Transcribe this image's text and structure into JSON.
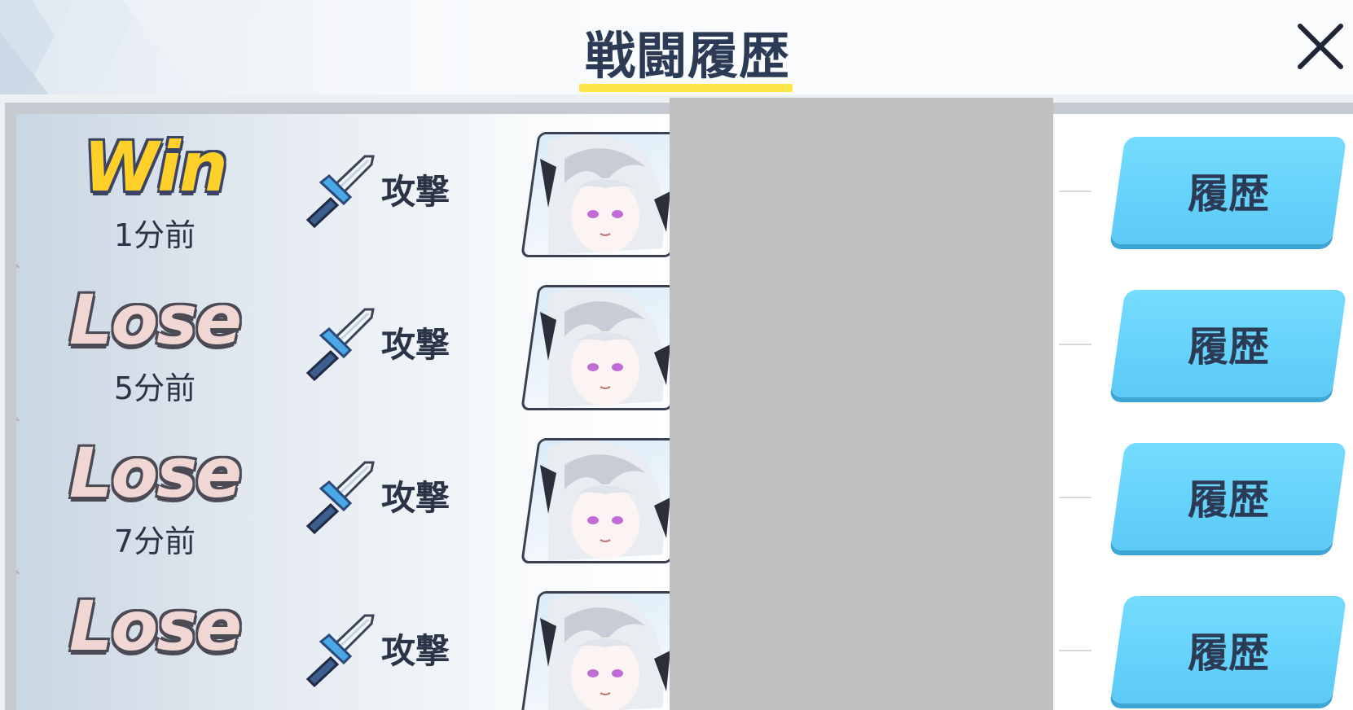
{
  "header": {
    "title": "戦闘履歴",
    "close_icon": "close-icon",
    "underline_color": "#ffe44a"
  },
  "battles": [
    {
      "result": "Win",
      "time": "1分前",
      "type": "攻撃",
      "button": "履歴"
    },
    {
      "result": "Lose",
      "time": "5分前",
      "type": "攻撃",
      "button": "履歴"
    },
    {
      "result": "Lose",
      "time": "7分前",
      "type": "攻撃",
      "button": "履歴"
    },
    {
      "result": "Lose",
      "time": "",
      "type": "攻撃",
      "button": "履歴"
    }
  ],
  "colors": {
    "win": "#ffcf2a",
    "lose": "#f0d7d3",
    "button": "#5ccaf6",
    "redacted": "#c0c0c0"
  }
}
